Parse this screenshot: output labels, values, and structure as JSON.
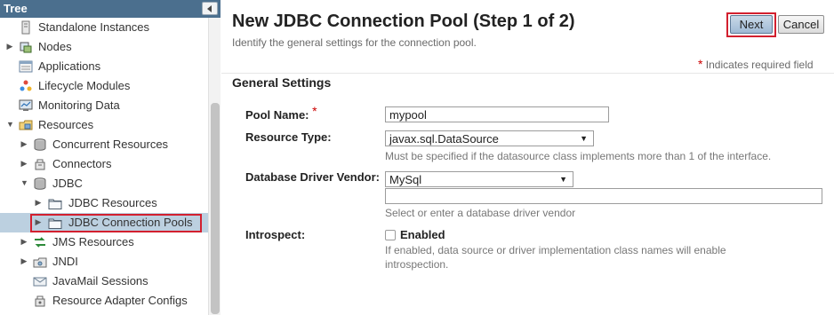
{
  "tree": {
    "title": "Tree",
    "items": [
      {
        "label": "Standalone Instances",
        "icon": "server-icon"
      },
      {
        "label": "Nodes",
        "icon": "nodes-icon"
      },
      {
        "label": "Applications",
        "icon": "applications-icon"
      },
      {
        "label": "Lifecycle Modules",
        "icon": "lifecycle-icon"
      },
      {
        "label": "Monitoring Data",
        "icon": "monitor-icon"
      },
      {
        "label": "Resources",
        "icon": "resources-icon"
      },
      {
        "label": "Concurrent Resources",
        "icon": "database-icon"
      },
      {
        "label": "Connectors",
        "icon": "connector-icon"
      },
      {
        "label": "JDBC",
        "icon": "database-icon"
      },
      {
        "label": "JDBC Resources",
        "icon": "folder-icon"
      },
      {
        "label": "JDBC Connection Pools",
        "icon": "folder-icon"
      },
      {
        "label": "JMS Resources",
        "icon": "jms-icon"
      },
      {
        "label": "JNDI",
        "icon": "jndi-icon"
      },
      {
        "label": "JavaMail Sessions",
        "icon": "mail-icon"
      },
      {
        "label": "Resource Adapter Configs",
        "icon": "adapter-icon"
      }
    ]
  },
  "page": {
    "title": "New JDBC Connection Pool (Step 1 of 2)",
    "help": "Identify the general settings for the connection pool.",
    "next_label": "Next",
    "cancel_label": "Cancel",
    "required_star": "*",
    "required_note": "Indicates required field",
    "section_title": "General Settings"
  },
  "form": {
    "pool_name_label": "Pool Name:",
    "pool_name_required": "*",
    "pool_name_value": "mypool",
    "resource_type_label": "Resource Type:",
    "resource_type_value": "javax.sql.DataSource",
    "resource_type_help": "Must be specified if the datasource class implements more than 1 of the interface.",
    "vendor_label": "Database Driver Vendor:",
    "vendor_value": "MySql",
    "vendor_text_value": "",
    "vendor_help": "Select or enter a database driver vendor",
    "introspect_label": "Introspect:",
    "introspect_checkbox_label": "Enabled",
    "introspect_help": "If enabled, data source or driver implementation class names will enable introspection."
  },
  "colors": {
    "tree_header": "#4b6f8e",
    "selected_row": "#bcd0e0",
    "highlight_outline": "#d2202f",
    "required_star": "#cc0000"
  }
}
